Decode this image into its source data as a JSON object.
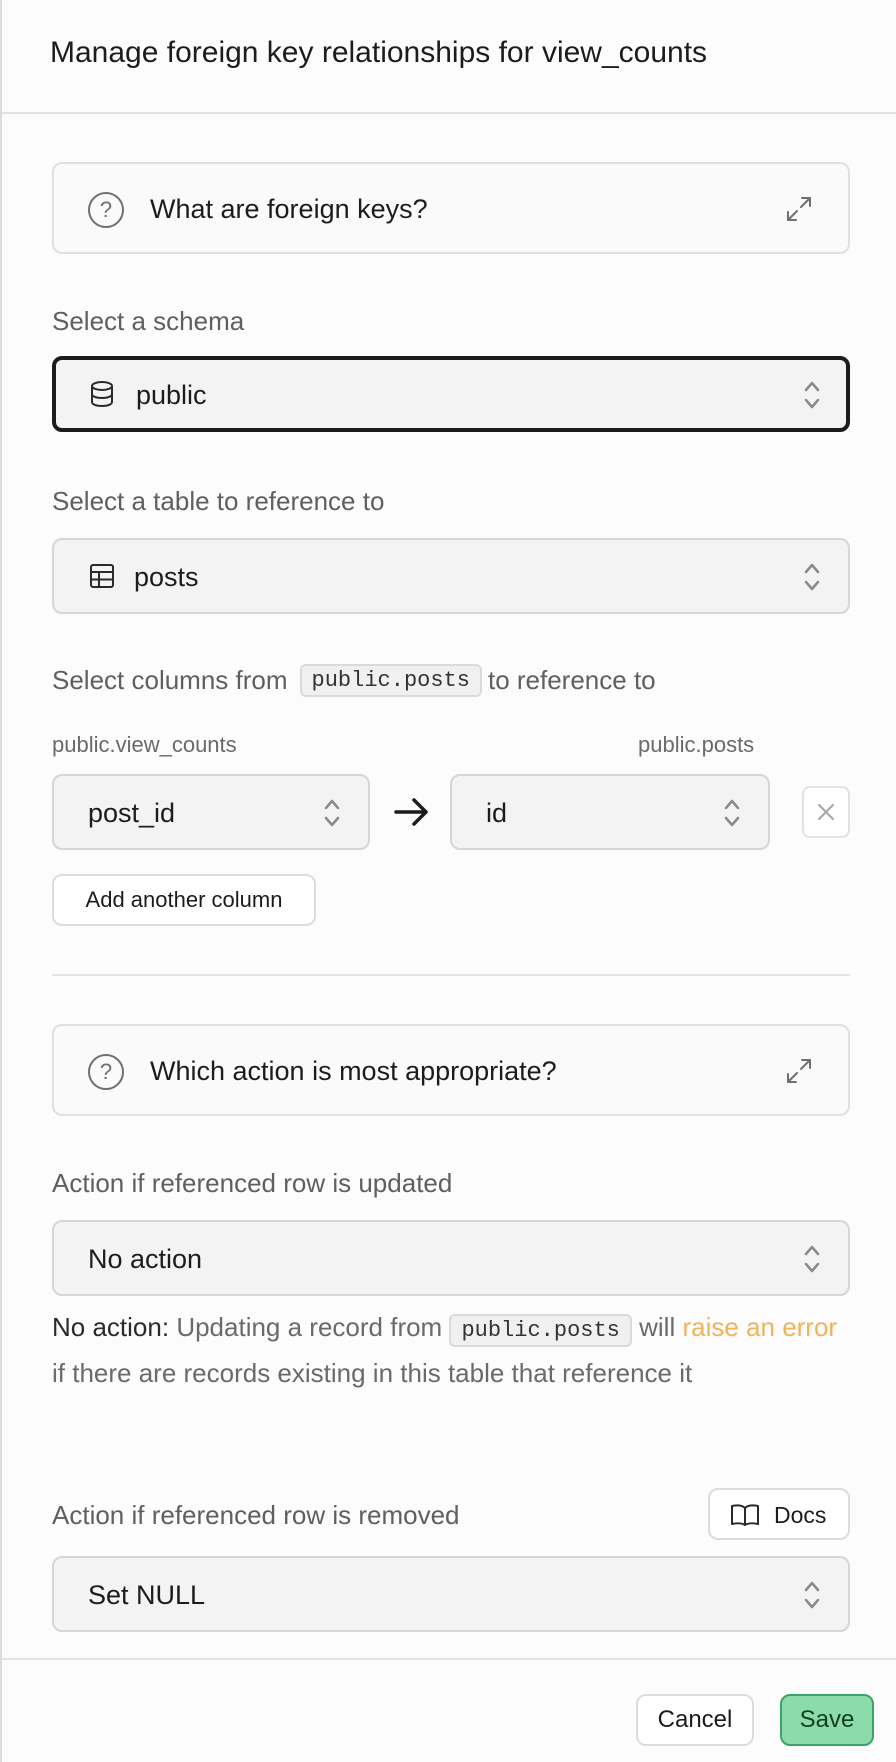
{
  "header": {
    "title": "Manage foreign key relationships for view_counts"
  },
  "help_foreign_keys": {
    "title": "What are foreign keys?"
  },
  "schema": {
    "label": "Select a schema",
    "value": "public"
  },
  "table": {
    "label": "Select a table to reference to",
    "value": "posts"
  },
  "columns": {
    "label_prefix": "Select columns from",
    "label_code": "public.posts",
    "label_suffix": "to reference to",
    "source_table": "public.view_counts",
    "target_table": "public.posts",
    "source_column": "post_id",
    "target_column": "id",
    "add_button": "Add another column"
  },
  "help_actions": {
    "title": "Which action is most appropriate?"
  },
  "on_update": {
    "label": "Action if referenced row is updated",
    "value": "No action",
    "desc_strong": "No action:",
    "desc_text1": "Updating a record from",
    "desc_code": "public.posts",
    "desc_text2": "will",
    "desc_warn": "raise an error",
    "desc_text3": "if there are records existing in this table that reference it"
  },
  "on_delete": {
    "label": "Action if referenced row is removed",
    "docs_button": "Docs",
    "value": "Set NULL"
  },
  "footer": {
    "cancel": "Cancel",
    "save": "Save"
  },
  "colors": {
    "save_bg": "#8cdcab",
    "save_border": "#3ba36a",
    "warn": "#f0b35a"
  }
}
